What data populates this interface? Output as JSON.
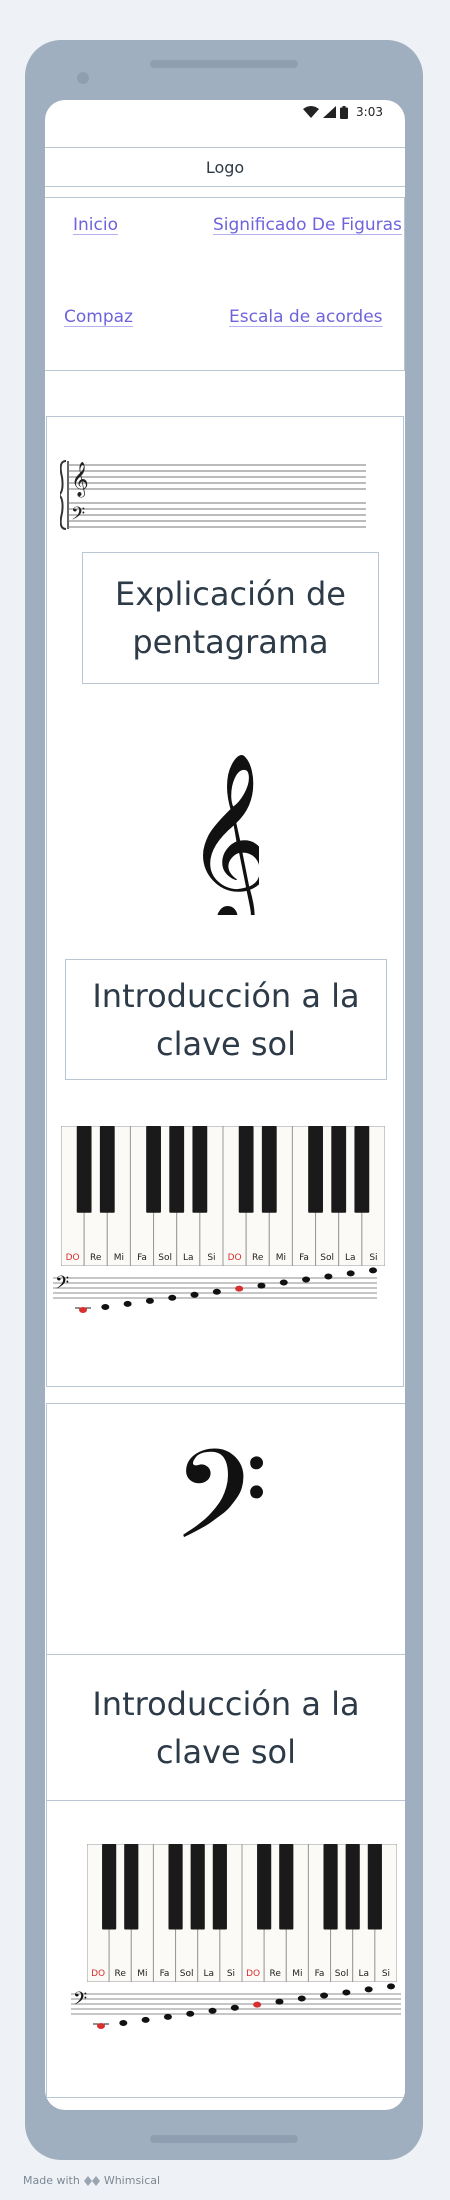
{
  "status": {
    "time": "3:03"
  },
  "header": {
    "logo": "Logo"
  },
  "nav": {
    "items": [
      {
        "label": "Inicio"
      },
      {
        "label": "Significado De Figuras"
      },
      {
        "label": "Compaz"
      },
      {
        "label": "Escala de acordes"
      }
    ]
  },
  "sections": {
    "pentagrama": {
      "title": "Explicación de pentagrama"
    },
    "clave_sol": {
      "title": "Introducción a la clave sol"
    },
    "clave_fa": {
      "title": "Introducción a la clave sol"
    }
  },
  "keyboard": {
    "note_labels": [
      "DO",
      "Re",
      "Mi",
      "Fa",
      "Sol",
      "La",
      "Si",
      "DO",
      "Re",
      "Mi",
      "Fa",
      "Sol",
      "La",
      "Si"
    ],
    "accent_color": "#d83030"
  },
  "footer": {
    "made_with": "Made with",
    "brand": "Whimsical"
  }
}
